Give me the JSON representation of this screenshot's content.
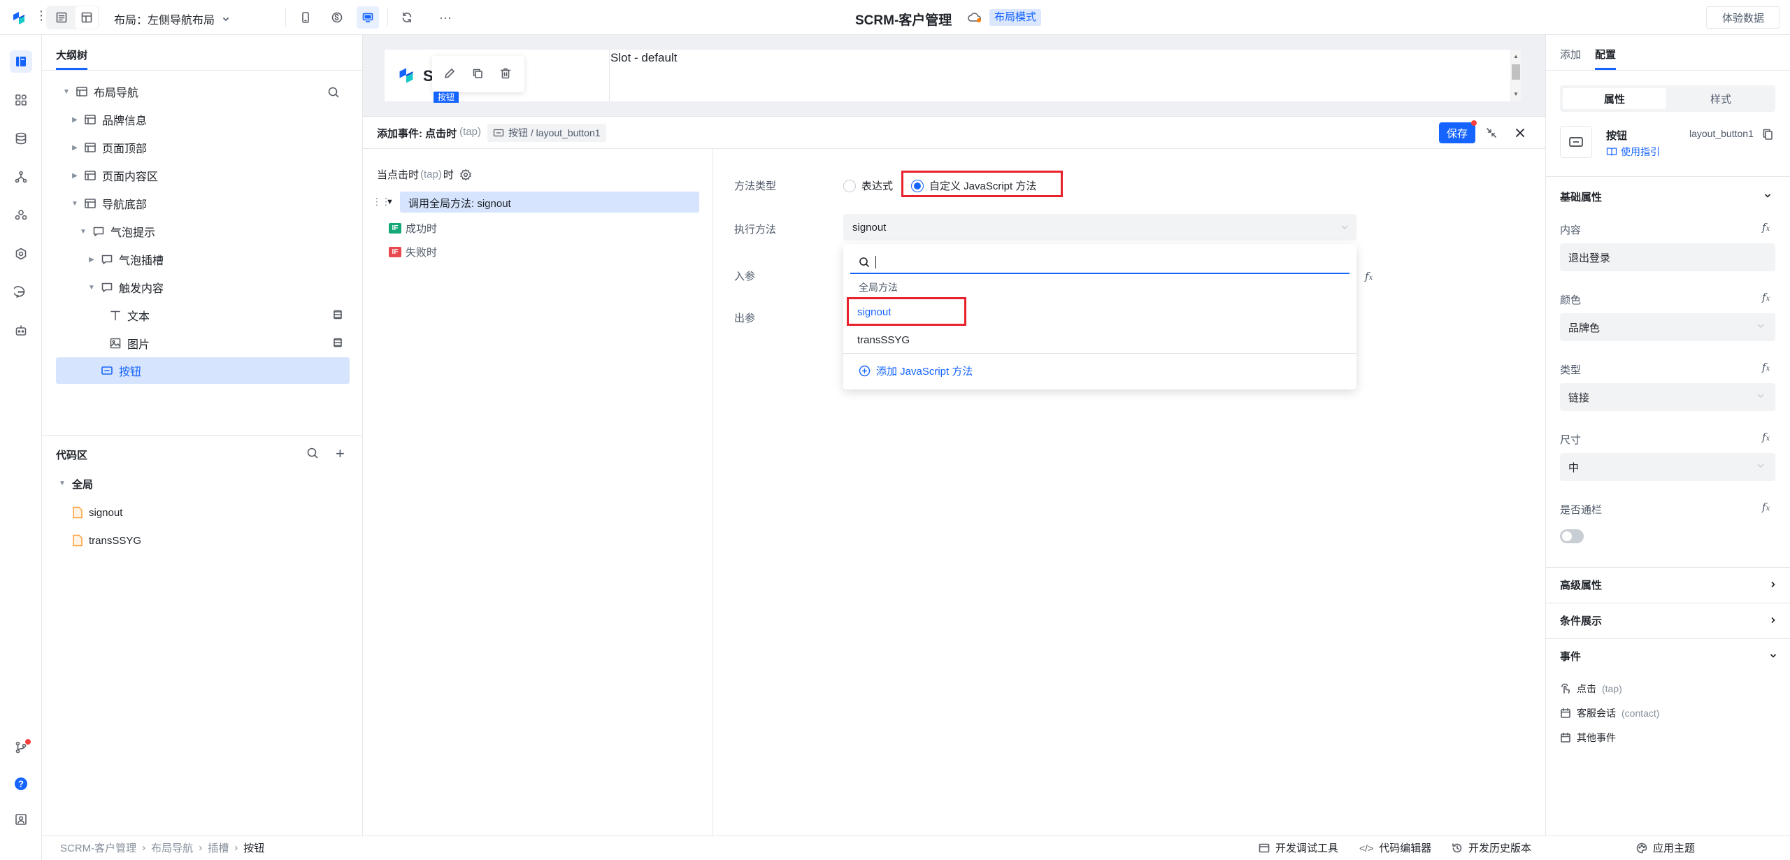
{
  "topbar": {
    "layout_label": "布局：左侧导航布局",
    "app_title": "SCRM-客户管理",
    "mode_badge": "布局模式",
    "experience_data": "体验数据"
  },
  "outline": {
    "title": "大纲树",
    "items": [
      {
        "label": "布局导航",
        "level": 0,
        "expanded": true
      },
      {
        "label": "品牌信息",
        "level": 1,
        "expanded": false
      },
      {
        "label": "页面顶部",
        "level": 1,
        "expanded": false
      },
      {
        "label": "页面内容区",
        "level": 1,
        "expanded": false
      },
      {
        "label": "导航底部",
        "level": 1,
        "expanded": true
      },
      {
        "label": "气泡提示",
        "level": 2,
        "expanded": true
      },
      {
        "label": "气泡插槽",
        "level": 3,
        "expanded": false
      },
      {
        "label": "触发内容",
        "level": 3,
        "expanded": true
      },
      {
        "label": "文本",
        "level": 4
      },
      {
        "label": "图片",
        "level": 4
      },
      {
        "label": "按钮",
        "level": 3,
        "selected": true
      }
    ]
  },
  "code_area": {
    "title": "代码区",
    "group": "全局",
    "files": [
      "signout",
      "transSSYG"
    ]
  },
  "canvas": {
    "slot_label": "Slot - default",
    "element_tag": "按钮",
    "logo_letter": "S"
  },
  "event_panel": {
    "title": "添加事件: 点击时",
    "title_tap": "(tap)",
    "target": "按钮 / layout_button1",
    "save": "保存",
    "trigger_prefix": "当点击时",
    "trigger_tap": "(tap)",
    "trigger_suffix": "时",
    "action": "调用全局方法: signout",
    "success": "成功时",
    "fail": "失败时",
    "if_badge": "IF",
    "method_type_label": "方法类型",
    "option_expression": "表达式",
    "option_custom": "自定义 JavaScript 方法",
    "exec_method_label": "执行方法",
    "exec_method_value": "signout",
    "input_param_label": "入参",
    "output_param_label": "出参",
    "dropdown": {
      "search_value": "",
      "group": "全局方法",
      "options": [
        "signout",
        "transSSYG"
      ],
      "add_method": "添加 JavaScript 方法"
    }
  },
  "right_panel": {
    "tabs": [
      "添加",
      "配置"
    ],
    "active_tab": "配置",
    "segment": [
      "属性",
      "样式"
    ],
    "component_name": "按钮",
    "component_id": "layout_button1",
    "usage_guide": "使用指引",
    "basic_props": "基础属性",
    "props": [
      {
        "label": "内容",
        "value": "退出登录",
        "type": "input"
      },
      {
        "label": "颜色",
        "value": "品牌色",
        "type": "select"
      },
      {
        "label": "类型",
        "value": "链接",
        "type": "select"
      },
      {
        "label": "尺寸",
        "value": "中",
        "type": "select"
      }
    ],
    "full_width_label": "是否通栏",
    "full_width_on": false,
    "fx": "fx",
    "advanced_props": "高级属性",
    "condition_display": "条件展示",
    "events_title": "事件",
    "events": [
      {
        "label": "点击",
        "sub": "(tap)"
      },
      {
        "label": "客服会话",
        "sub": "(contact)"
      },
      {
        "label": "其他事件",
        "sub": ""
      }
    ]
  },
  "statusbar": {
    "breadcrumb": [
      "SCRM-客户管理",
      "布局导航",
      "插槽",
      "按钮"
    ],
    "dev_tools": "开发调试工具",
    "code_editor": "代码编辑器",
    "history": "开发历史版本",
    "theme": "应用主题"
  },
  "colors": {
    "primary": "#1664ff",
    "highlight_red": "#e8222d",
    "selected_bg": "#d6e4fd",
    "success_badge": "#14a878",
    "fail_badge": "#e8484f"
  }
}
